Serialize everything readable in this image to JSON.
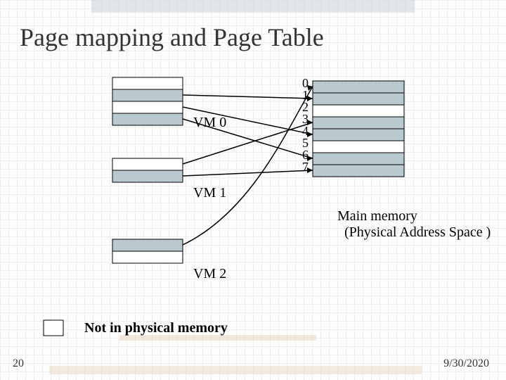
{
  "title": "Page mapping and Page Table",
  "vm_labels": {
    "vm0": "VM 0",
    "vm1": "VM 1",
    "vm2": "VM 2"
  },
  "frame_numbers": [
    "0",
    "1",
    "2",
    "3",
    "4",
    "5",
    "6",
    "7"
  ],
  "caption": {
    "line1": "Main memory",
    "line2": "(Physical Address Space )"
  },
  "legend": "Not in physical memory",
  "slide_number": "20",
  "date": "9/30/2020",
  "chart_data": {
    "type": "diagram",
    "title": "Page mapping and Page Table",
    "virtual_memory_blocks": [
      {
        "name": "VM 0",
        "pages": 4
      },
      {
        "name": "VM 1",
        "pages": 2
      },
      {
        "name": "VM 2",
        "pages": 2
      }
    ],
    "physical_frames": 8,
    "mappings": [
      {
        "vm": "VM 0",
        "page": 0,
        "frame": null
      },
      {
        "vm": "VM 0",
        "page": 1,
        "frame": 1
      },
      {
        "vm": "VM 0",
        "page": 2,
        "frame": 4
      },
      {
        "vm": "VM 0",
        "page": 3,
        "frame": 6
      },
      {
        "vm": "VM 1",
        "page": 0,
        "frame": 3
      },
      {
        "vm": "VM 1",
        "page": 1,
        "frame": 7
      },
      {
        "vm": "VM 2",
        "page": 0,
        "frame": 0
      },
      {
        "vm": "VM 2",
        "page": 1,
        "frame": null
      }
    ],
    "legend": {
      "unmapped": "Not in physical memory"
    }
  }
}
